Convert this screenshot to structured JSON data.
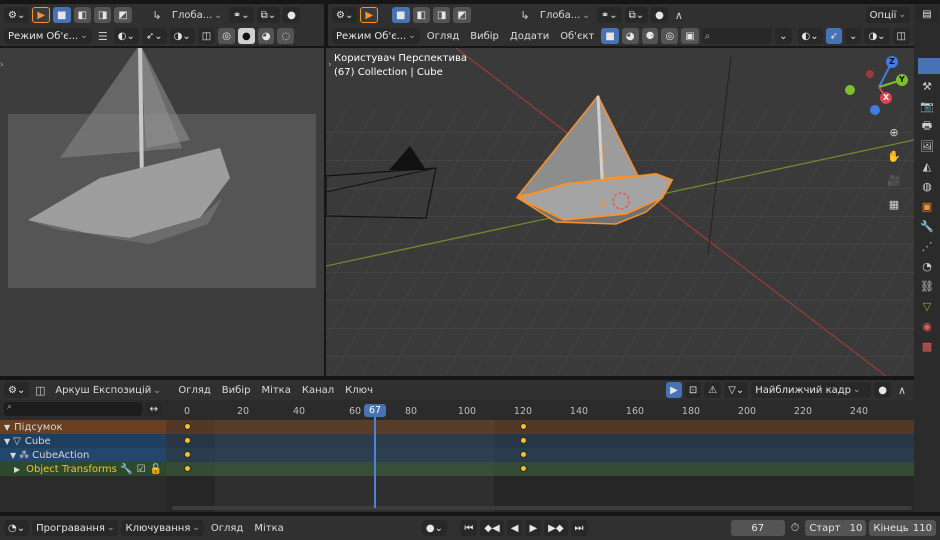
{
  "left_view": {
    "mode": "Режим Об'є...",
    "transform": "Глоба..."
  },
  "main_view": {
    "transform": "Глоба...",
    "options": "Опції",
    "mode": "Режим Об'є...",
    "menu": [
      "Огляд",
      "Вибір",
      "Додати",
      "Об'єкт"
    ],
    "overlay_title": "Користувач Перспектива",
    "overlay_sub": "(67) Collection | Cube",
    "gizmo": {
      "x": "X",
      "y": "Y",
      "z": "Z"
    }
  },
  "dopesheet": {
    "mode": "Аркуш Експозицій",
    "menu": [
      "Огляд",
      "Вибір",
      "Мітка",
      "Канал",
      "Ключ"
    ],
    "snap": "Найближчий кадр",
    "ticks": [
      "0",
      "20",
      "40",
      "60",
      "80",
      "100",
      "120",
      "140",
      "160",
      "180",
      "200",
      "220",
      "240"
    ],
    "current_frame": "67",
    "channels": [
      {
        "label": "Підсумок",
        "color": "#6a3f1f"
      },
      {
        "label": "Cube",
        "color": "#1f3f5f"
      },
      {
        "label": "CubeAction",
        "color": "#23476b"
      },
      {
        "label": "Object Transforms",
        "color": "#2e4a2e"
      }
    ],
    "keyframes": [
      0,
      120
    ]
  },
  "playback": {
    "menu": [
      "Програвання",
      "Ключування",
      "Огляд",
      "Мітка"
    ],
    "frame": "67",
    "start_label": "Старт",
    "start": "10",
    "end_label": "Кінець",
    "end": "110"
  },
  "colors": {
    "accent": "#4772b3",
    "keyframe": "#f0c22d",
    "selection": "#f5912e",
    "playhead": "#4f83d6"
  }
}
